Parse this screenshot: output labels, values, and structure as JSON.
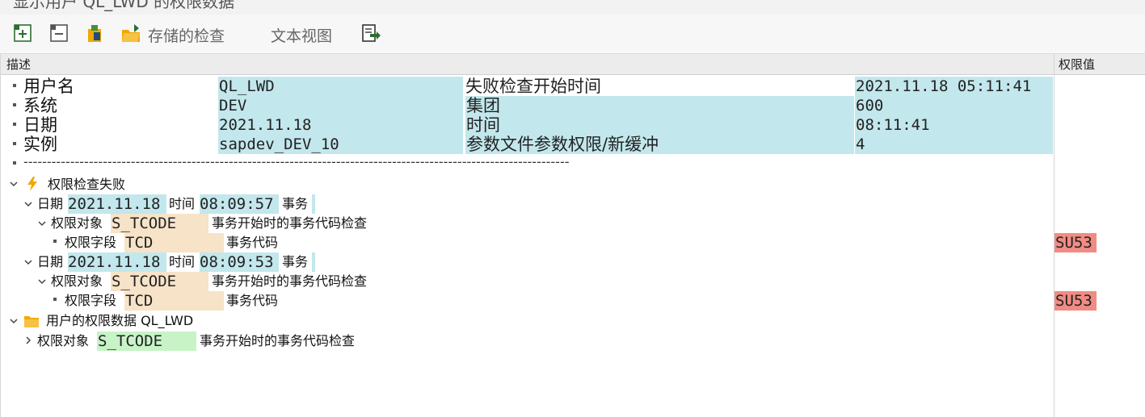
{
  "window": {
    "title": "显示用户 QL_LWD 的权限数据"
  },
  "toolbar": {
    "buttons": [
      {
        "icon": "expand-all-icon"
      },
      {
        "icon": "collapse-all-icon"
      },
      {
        "icon": "clipboard-icon"
      },
      {
        "icon": "open-folder-icon",
        "label": "存储的检查"
      },
      {
        "label": "文本视图"
      },
      {
        "icon": "export-icon"
      }
    ]
  },
  "columns": {
    "description": "描述",
    "auth_value": "权限值"
  },
  "header": {
    "rows": [
      {
        "label": "用户名",
        "value": "QL_LWD",
        "label2": "失败检查开始时间",
        "value2": "2021.11.18 05:11:41"
      },
      {
        "label": "系统",
        "value": "DEV",
        "label2": "集团",
        "value2": "600"
      },
      {
        "label": "日期",
        "value": "2021.11.18",
        "label2": "时间",
        "value2": "08:11:41"
      },
      {
        "label": "实例",
        "value": "sapdev_DEV_10",
        "label2": "参数文件参数权限/新缓冲",
        "value2": "4"
      }
    ],
    "separator": "---------------------------------------------------------------------------------------------------------------------"
  },
  "tree": {
    "failed": {
      "label": "权限检查失败",
      "entries": [
        {
          "date_label": "日期",
          "date": "2021.11.18",
          "time_label": "时间",
          "time": "08:09:57",
          "tx_label": "事务",
          "object": {
            "label": "权限对象",
            "name": "S_TCODE",
            "desc": "事务开始时的事务代码检查",
            "field": {
              "label": "权限字段",
              "name": "TCD",
              "desc": "事务代码",
              "value": "SU53"
            }
          }
        },
        {
          "date_label": "日期",
          "date": "2021.11.18",
          "time_label": "时间",
          "time": "08:09:53",
          "tx_label": "事务",
          "object": {
            "label": "权限对象",
            "name": "S_TCODE",
            "desc": "事务开始时的事务代码检查",
            "field": {
              "label": "权限字段",
              "name": "TCD",
              "desc": "事务代码",
              "value": "SU53"
            }
          }
        }
      ]
    },
    "user_data": {
      "label": "用户的权限数据 QL_LWD",
      "object": {
        "label": "权限对象",
        "name": "S_TCODE",
        "desc": "事务开始时的事务代码检查"
      }
    }
  },
  "colors": {
    "teal": "#c2e7ec",
    "tan": "#f6e3c8",
    "green": "#c7f3c7",
    "red": "#f08c84",
    "accent": "#f0a800"
  }
}
